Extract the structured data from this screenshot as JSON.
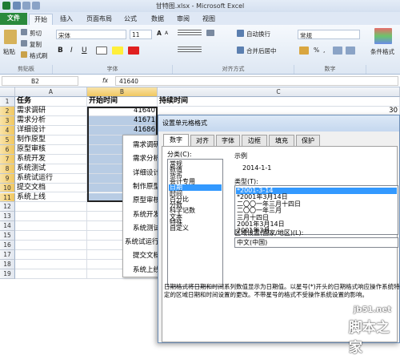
{
  "window": {
    "title": "甘特图.xlsx - Microsoft Excel"
  },
  "tabs": [
    "文件",
    "开始",
    "插入",
    "页面布局",
    "公式",
    "数据",
    "审阅",
    "视图"
  ],
  "ribbon": {
    "clipboard": {
      "cut": "剪切",
      "copy": "复制",
      "paste": "粘贴",
      "format_painter": "格式刷",
      "group": "剪贴板"
    },
    "font": {
      "family": "宋体",
      "size": "11",
      "bold": "B",
      "italic": "I",
      "underline": "U",
      "group": "字体"
    },
    "alignment": {
      "wrap": "自动换行",
      "merge": "合并后居中",
      "group": "对齐方式"
    },
    "number": {
      "format": "常规",
      "percent": "%",
      "group": "数字"
    },
    "styles": {
      "conditional": "条件格式"
    }
  },
  "formula_bar": {
    "name_box": "B2",
    "fx": "fx",
    "value": "41640"
  },
  "grid": {
    "columns": [
      "A",
      "B",
      "C"
    ],
    "rows": [
      "1",
      "2",
      "3",
      "4",
      "5",
      "6",
      "7",
      "8",
      "9",
      "10",
      "11",
      "12",
      "13",
      "14",
      "15",
      "16",
      "17",
      "18",
      "19"
    ],
    "headers": {
      "a1": "任务",
      "b1": "开始时间",
      "c1": "持续时间"
    },
    "col_a": [
      "需求调研",
      "需求分析",
      "详细设计",
      "制作原型",
      "原型审核",
      "系统开发",
      "系统测试",
      "系统试运行",
      "提交文档",
      "系统上线"
    ],
    "col_b": [
      "41640",
      "41671",
      "41686"
    ],
    "col_c1": "30"
  },
  "context_list": [
    "需求调研",
    "需求分析",
    "详细设计",
    "制作原型",
    "原型审核",
    "系统开发",
    "系统测试",
    "系统试运行",
    "提交文档",
    "系统上线"
  ],
  "dialog": {
    "title": "设置单元格格式",
    "tabs": [
      "数字",
      "对齐",
      "字体",
      "边框",
      "填充",
      "保护"
    ],
    "category_label": "分类(C):",
    "categories": [
      "常规",
      "数值",
      "货币",
      "会计专用",
      "日期",
      "时间",
      "百分比",
      "分数",
      "科学记数",
      "文本",
      "特殊",
      "自定义"
    ],
    "selected_category": "日期",
    "sample_label": "示例",
    "sample_value": "2014-1-1",
    "type_label": "类型(T):",
    "types": [
      "*2001-3-14",
      "*2001年3月14日",
      "二〇〇一年三月十四日",
      "二〇〇一年三月",
      "三月十四日",
      "2001年3月14日",
      "2001年3月"
    ],
    "locale_label": "区域设置(国家/地区)(L):",
    "locale_value": "中文(中国)",
    "description": "日期格式将日期和时间系列数值显示为日期值。以星号(*)开头的日期格式响应操作系统特定的区域日期和时间设置的更改。不带星号的格式不受操作系统设置的影响。"
  },
  "watermark": {
    "site": "jb51.net",
    "brand": "脚本之家"
  },
  "colors": {
    "file_tab": "#2a8a3c",
    "selection": "#3399ff",
    "dialog_title": "#c5d8ef"
  }
}
